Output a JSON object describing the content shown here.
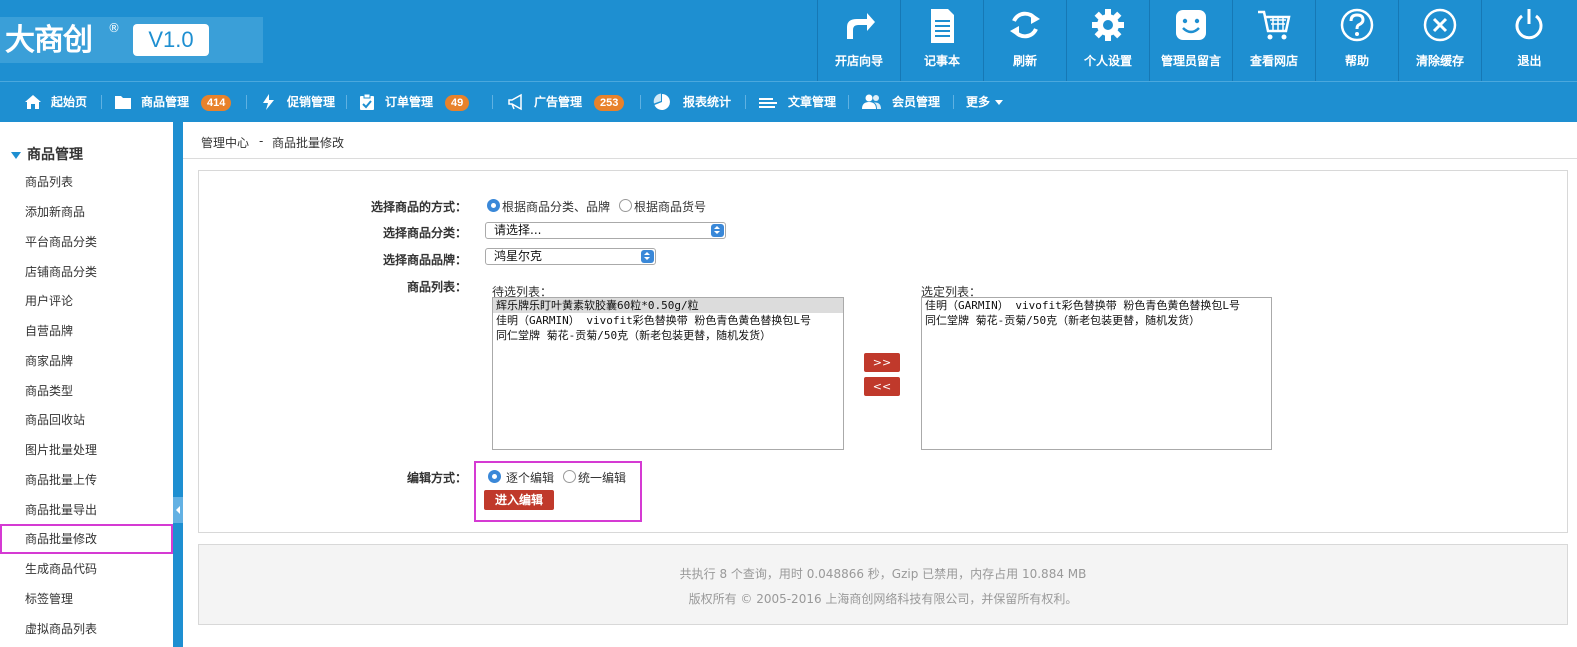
{
  "app": {
    "logo_text": "大商创",
    "logo_reg": "®",
    "version": "V1.0"
  },
  "header_buttons": [
    {
      "label": "开店向导",
      "icon": "share-arrow-icon"
    },
    {
      "label": "记事本",
      "icon": "notepad-icon"
    },
    {
      "label": "刷新",
      "icon": "refresh-icon"
    },
    {
      "label": "个人设置",
      "icon": "gear-icon"
    },
    {
      "label": "管理员留言",
      "icon": "smiley-message-icon"
    },
    {
      "label": "查看网店",
      "icon": "cart-icon"
    },
    {
      "label": "帮助",
      "icon": "help-icon"
    },
    {
      "label": "清除缓存",
      "icon": "close-circle-icon"
    },
    {
      "label": "退出",
      "icon": "power-icon"
    }
  ],
  "nav": {
    "items": [
      {
        "label": "起始页",
        "icon": "home-icon"
      },
      {
        "label": "商品管理",
        "icon": "folder-icon",
        "badge": "414"
      },
      {
        "label": "促销管理",
        "icon": "bolt-icon"
      },
      {
        "label": "订单管理",
        "icon": "clipboard-icon",
        "badge": "49"
      },
      {
        "label": "广告管理",
        "icon": "megaphone-icon",
        "badge": "253"
      },
      {
        "label": "报表统计",
        "icon": "pie-chart-icon"
      },
      {
        "label": "文章管理",
        "icon": "lines-icon"
      },
      {
        "label": "会员管理",
        "icon": "users-icon"
      },
      {
        "label": "更多",
        "icon": "caret-down-icon"
      }
    ]
  },
  "sidebar": {
    "title": "商品管理",
    "items": [
      {
        "label": "商品列表"
      },
      {
        "label": "添加新商品"
      },
      {
        "label": "平台商品分类"
      },
      {
        "label": "店铺商品分类"
      },
      {
        "label": "用户评论"
      },
      {
        "label": "自营品牌"
      },
      {
        "label": "商家品牌"
      },
      {
        "label": "商品类型"
      },
      {
        "label": "商品回收站"
      },
      {
        "label": "图片批量处理"
      },
      {
        "label": "商品批量上传"
      },
      {
        "label": "商品批量导出"
      },
      {
        "label": "商品批量修改",
        "active": true
      },
      {
        "label": "生成商品代码"
      },
      {
        "label": "标签管理"
      },
      {
        "label": "虚拟商品列表"
      }
    ]
  },
  "breadcrumb": {
    "root": "管理中心",
    "sep": "-",
    "current": "商品批量修改"
  },
  "form": {
    "select_method_label": "选择商品的方式：",
    "method_options": [
      {
        "label": "根据商品分类、品牌",
        "checked": true
      },
      {
        "label": "根据商品货号",
        "checked": false
      }
    ],
    "category_label": "选择商品分类：",
    "category_value": "请选择...",
    "brand_label": "选择商品品牌：",
    "brand_value": "鸿星尔克",
    "goods_list_label": "商品列表：",
    "pending_caption": "待选列表：",
    "pending_items": [
      {
        "text": "辉乐牌乐盯叶黄素软胶囊60粒*0.50g/粒",
        "selected": true
      },
      {
        "text": "佳明（GARMIN） vivofit彩色替换带 粉色青色黄色替换包L号",
        "selected": false
      },
      {
        "text": "同仁堂牌 菊花-贡菊/50克（新老包装更替，随机发货）",
        "selected": false
      }
    ],
    "selected_caption": "选定列表：",
    "selected_items": [
      {
        "text": "佳明（GARMIN） vivofit彩色替换带 粉色青色黄色替换包L号"
      },
      {
        "text": "同仁堂牌 菊花-贡菊/50克（新老包装更替，随机发货）"
      }
    ],
    "add_btn": ">>",
    "remove_btn": "<<",
    "edit_mode_label": "编辑方式：",
    "edit_options": [
      {
        "label": "逐个编辑",
        "checked": true
      },
      {
        "label": "统一编辑",
        "checked": false
      }
    ],
    "enter_btn": "进入编辑"
  },
  "footer": {
    "line1": "共执行 8 个查询，用时 0.048866 秒，Gzip 已禁用，内存占用 10.884 MB",
    "line2": "版权所有 © 2005-2016 上海商创网络科技有限公司，并保留所有权利。"
  },
  "colors": {
    "header_bg": "#1e8fd1",
    "badge": "#e8822b",
    "button_red": "#c0392b",
    "highlight_outline": "#d53ad3"
  }
}
